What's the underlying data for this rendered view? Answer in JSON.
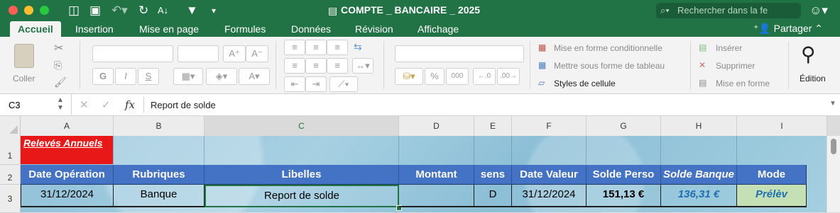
{
  "app": {
    "title": "COMPTE _ BANCAIRE _ 2025",
    "search_placeholder": "Rechercher dans la fe"
  },
  "tabs": [
    {
      "label": "Accueil",
      "active": true
    },
    {
      "label": "Insertion"
    },
    {
      "label": "Mise en page"
    },
    {
      "label": "Formules"
    },
    {
      "label": "Données"
    },
    {
      "label": "Révision"
    },
    {
      "label": "Affichage"
    }
  ],
  "share_label": "Partager",
  "ribbon": {
    "paste_label": "Coller",
    "bold": "G",
    "italic": "I",
    "underline": "S",
    "percent": "%",
    "thousands": "000",
    "conditional_format": "Mise en forme conditionnelle",
    "format_table": "Mettre sous forme de tableau",
    "cell_styles": "Styles de cellule",
    "insert": "Insérer",
    "delete": "Supprimer",
    "format": "Mise en forme",
    "editing": "Édition"
  },
  "formula_bar": {
    "cell_ref": "C3",
    "fx": "fx",
    "content": "Report de solde"
  },
  "columns": [
    "A",
    "B",
    "C",
    "D",
    "E",
    "F",
    "G",
    "H",
    "I"
  ],
  "rows": [
    "1",
    "2",
    "3"
  ],
  "sheet": {
    "a1": "Relevés Annuels",
    "headers": [
      "Date Opération",
      "Rubriques",
      "Libelles",
      "Montant",
      "sens",
      "Date Valeur",
      "Solde Perso",
      "Solde Banque",
      "Mode"
    ],
    "row3": [
      "31/12/2024",
      "Banque",
      "Report de solde",
      "",
      "D",
      "31/12/2024",
      "151,13 €",
      "136,31 €",
      "Prélèv"
    ]
  },
  "colors": {
    "brand": "#217346",
    "header_fill": "#4472c4",
    "a1_fill": "#e81818",
    "solde_banque_text": "#1f6fb2",
    "mode_fill": "#c5e0b4"
  }
}
